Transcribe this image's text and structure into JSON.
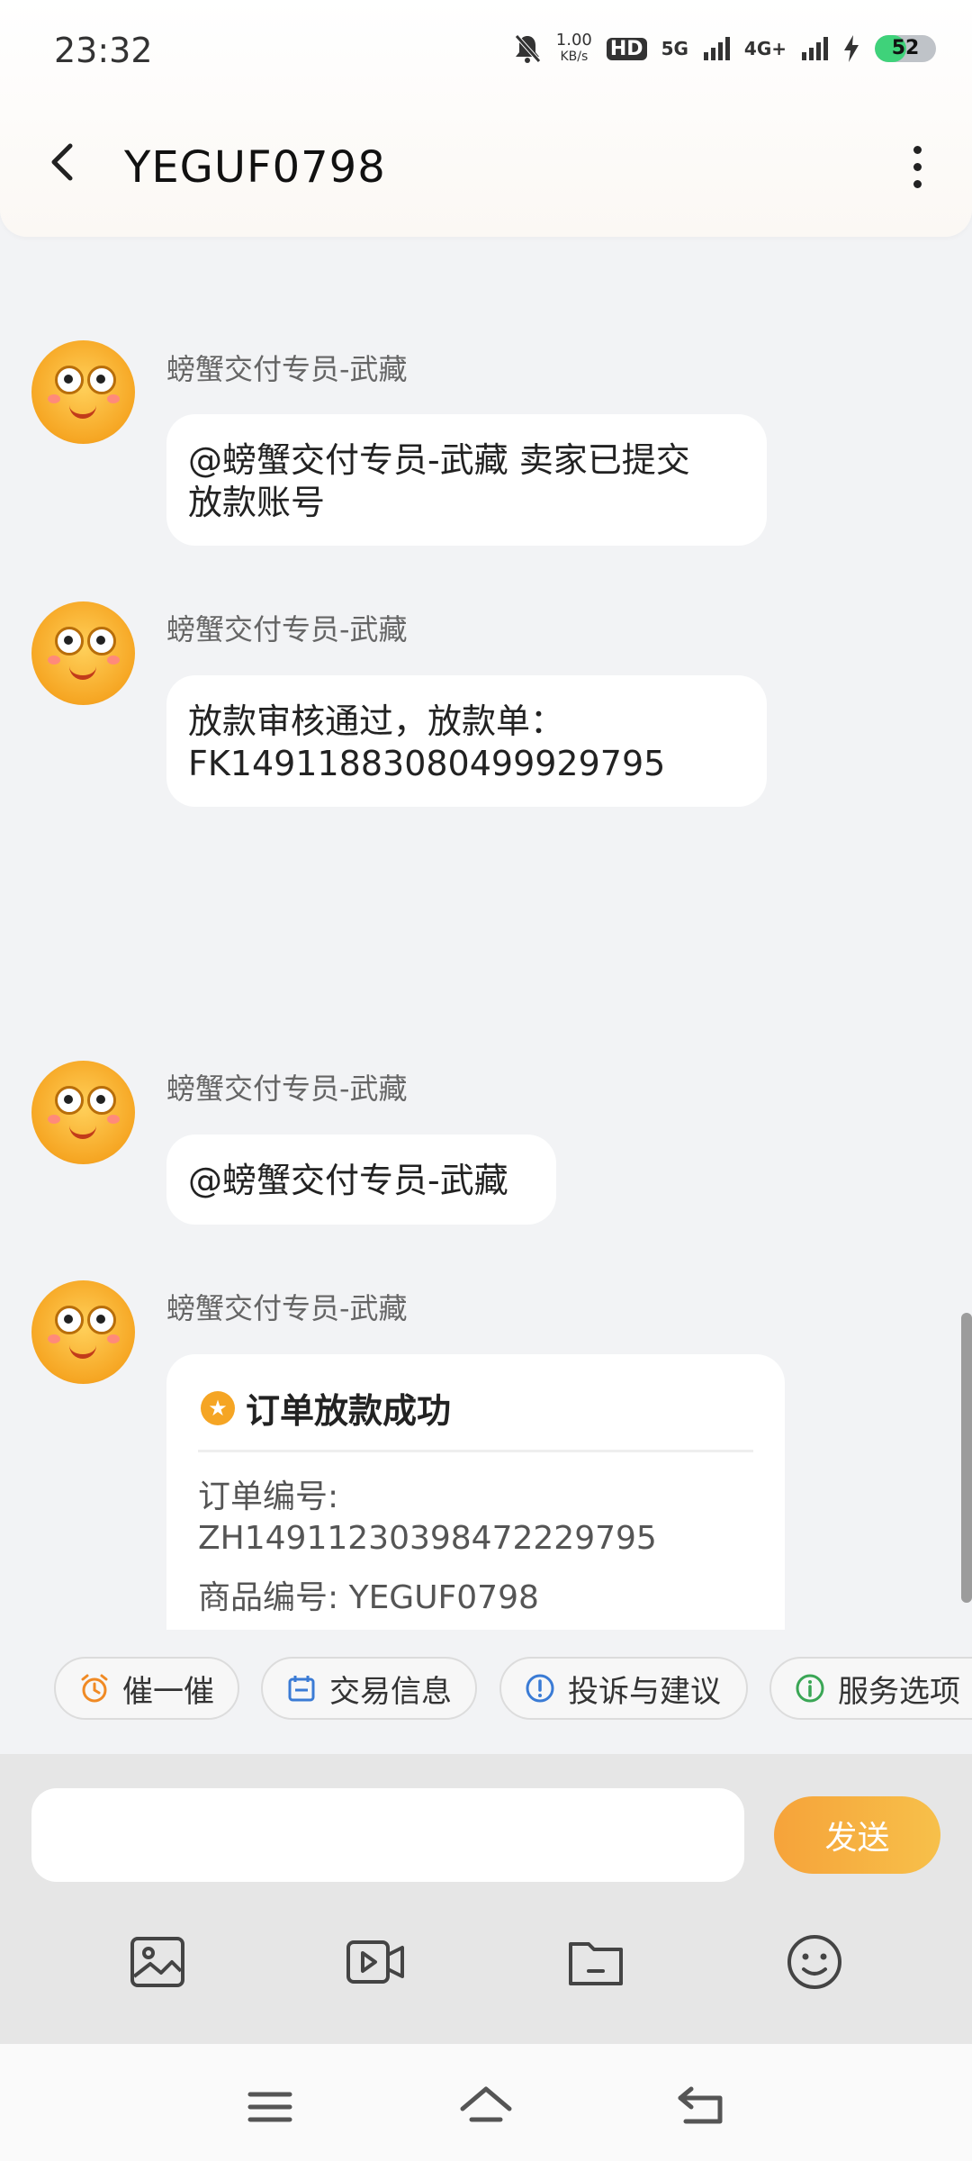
{
  "status_bar": {
    "time": "23:32",
    "net_speed_value": "1.00",
    "net_speed_unit": "KB/s",
    "hd_label": "HD",
    "signal_5g_label": "5G",
    "signal_4g_label": "4G+",
    "battery_level": "52",
    "battery_fraction": 0.52,
    "icons": [
      "mute-icon",
      "hd-icon",
      "signal-5g-icon",
      "signal-4g-icon",
      "charging-icon",
      "battery-icon"
    ]
  },
  "header": {
    "title": "YEGUF0798",
    "back_icon": "back-arrow-icon",
    "more_icon": "more-vertical-icon"
  },
  "messages": [
    {
      "sender": "螃蟹交付专员-武藏",
      "lines": [
        "@螃蟹交付专员-武藏 卖家已提交",
        "放款账号"
      ]
    },
    {
      "sender": "螃蟹交付专员-武藏",
      "lines": [
        "放款审核通过，放款单：",
        "FK14911883080499929795"
      ]
    },
    {
      "sender": "螃蟹交付专员-武藏",
      "lines": [
        "@螃蟹交付专员-武藏"
      ]
    },
    {
      "sender": "螃蟹交付专员-武藏"
    }
  ],
  "card": {
    "title": "订单放款成功",
    "order_label": "订单编号:",
    "order_number": "ZH14911230398472229795",
    "product_line": "商品编号: YEGUF0798"
  },
  "quick_actions": [
    {
      "label": "催一催",
      "icon": "alarm-clock-icon"
    },
    {
      "label": "交易信息",
      "icon": "calendar-icon"
    },
    {
      "label": "投诉与建议",
      "icon": "exclamation-icon"
    },
    {
      "label": "服务选项",
      "icon": "info-icon"
    }
  ],
  "input": {
    "placeholder": "",
    "send_label": "发送"
  },
  "toolbar": [
    "image-icon",
    "video-icon",
    "folder-icon",
    "emoji-icon"
  ],
  "nav": [
    "menu-icon",
    "home-icon",
    "back-icon"
  ],
  "colors": {
    "accent": "#f6a33a",
    "background": "#f2f3f5",
    "bubble": "#ffffff"
  }
}
